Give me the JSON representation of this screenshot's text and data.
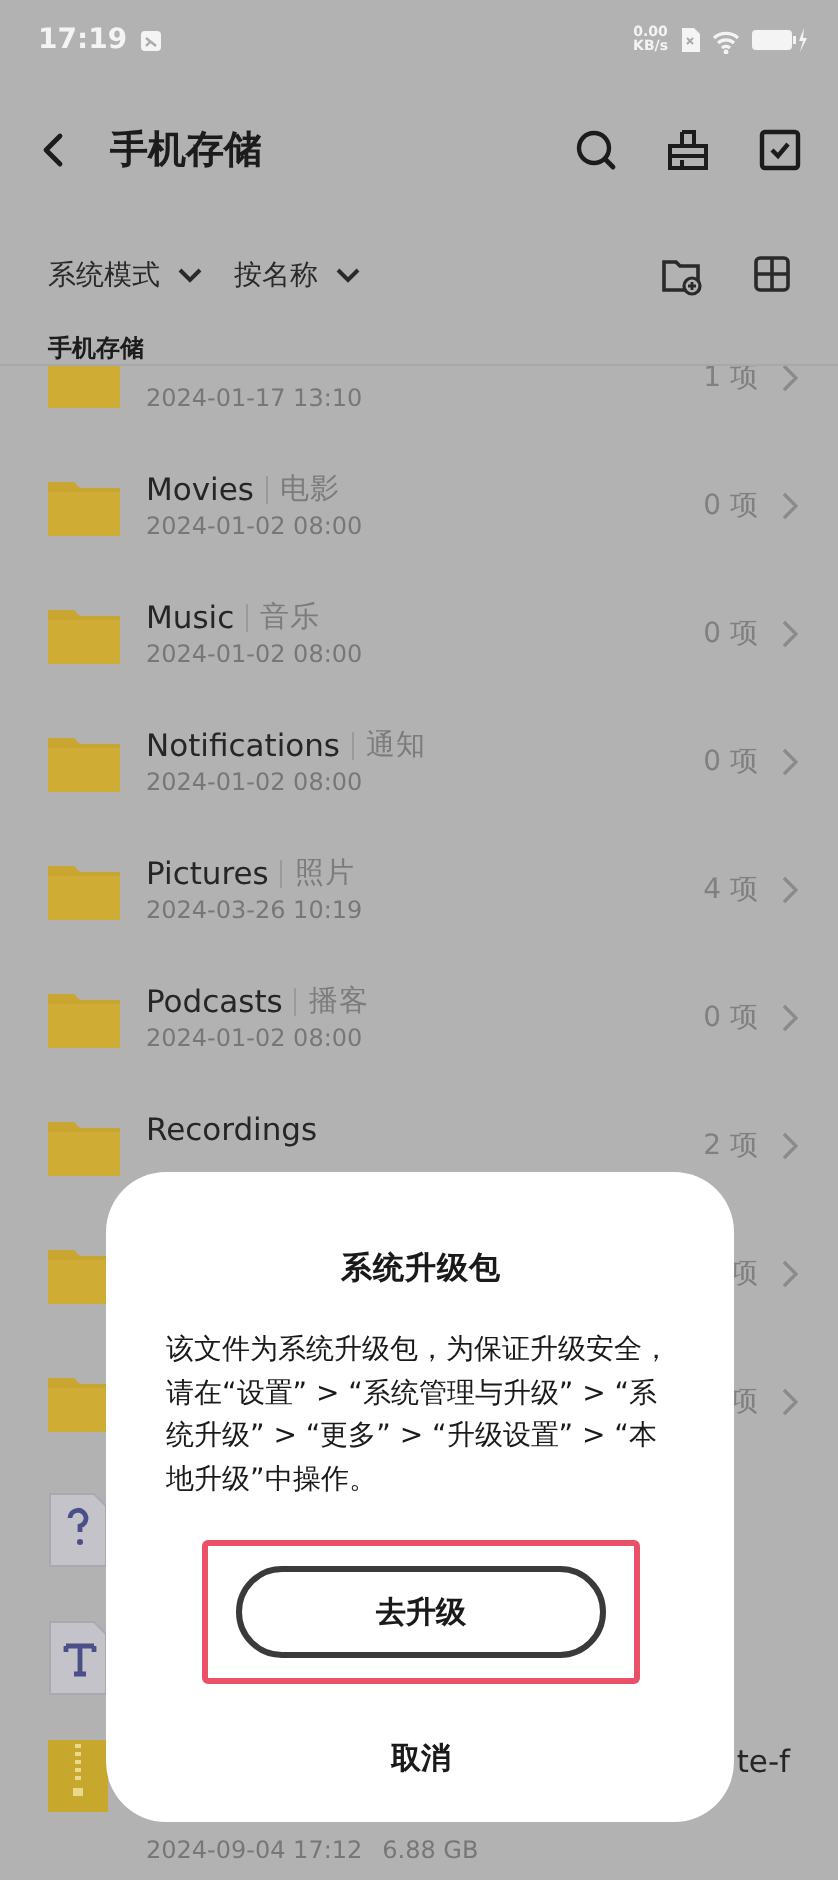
{
  "status_bar": {
    "time": "17:19",
    "net_speed": "0.00",
    "net_unit": "KB/s"
  },
  "toolbar": {
    "title": "手机存储"
  },
  "filters": [
    {
      "label": "系统模式"
    },
    {
      "label": "按名称"
    }
  ],
  "section_title": "手机存储",
  "files": [
    {
      "kind": "folder",
      "date": "2024-01-17 13:10",
      "count": "1 项"
    },
    {
      "kind": "folder",
      "name": "Movies",
      "tag": "电影",
      "date": "2024-01-02 08:00",
      "count": "0 项"
    },
    {
      "kind": "folder",
      "name": "Music",
      "tag": "音乐",
      "date": "2024-01-02 08:00",
      "count": "0 项"
    },
    {
      "kind": "folder",
      "name": "Notifications",
      "tag": "通知",
      "date": "2024-01-02 08:00",
      "count": "0 项"
    },
    {
      "kind": "folder",
      "name": "Pictures",
      "tag": "照片",
      "date": "2024-03-26 10:19",
      "count": "4 项"
    },
    {
      "kind": "folder",
      "name": "Podcasts",
      "tag": "播客",
      "date": "2024-01-02 08:00",
      "count": "0 项"
    },
    {
      "kind": "folder",
      "name": "Recordings",
      "count": "2 项"
    },
    {
      "kind": "folder",
      "count": "项"
    },
    {
      "kind": "folder",
      "count": "项"
    },
    {
      "kind": "unknown"
    },
    {
      "kind": "text"
    },
    {
      "kind": "archive",
      "name": "te-f",
      "covered": true,
      "date": "2024-09-04 17:12",
      "size": "6.88 GB"
    }
  ],
  "dialog": {
    "title": "系统升级包",
    "message": "该文件为系统升级包，为保证升级安全，请在“设置” > “系统管理与升级” > “系统升级” > “更多” > “升级设置” > “本地升级”中操作。",
    "buttons": [
      {
        "label": "去升级",
        "kind": "primary",
        "highlighted": true
      },
      {
        "label": "取消",
        "kind": "text",
        "highlighted": false
      }
    ]
  }
}
